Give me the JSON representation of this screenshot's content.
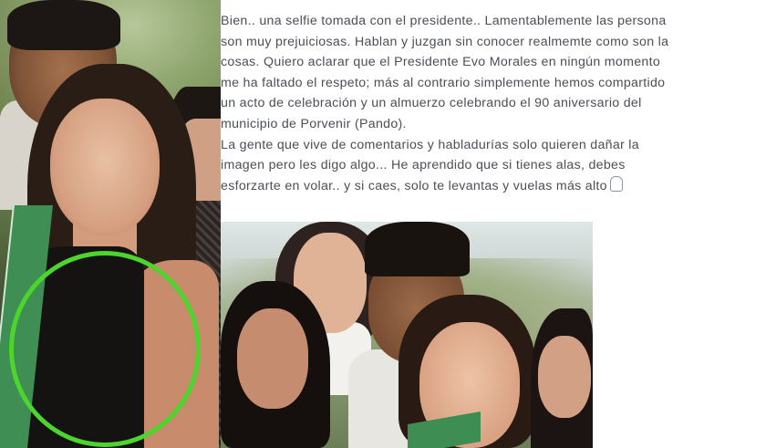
{
  "post": {
    "lines": [
      "Bien.. una selfie tomada con el presidente.. Lamentablemente las persona",
      "son muy prejuiciosas. Hablan y juzgan sin conocer realmemte como son la",
      "cosas. Quiero aclarar que el Presidente Evo Morales en ningún momento",
      "me ha faltado el respeto; más al contrario simplemente hemos compartido",
      "un acto de celebración y un almuerzo celebrando el 90 aniversario del",
      "municipio de Porvenir (Pando).",
      "La gente que vive de comentarios y habladurías solo quieren dañar la",
      "imagen pero les digo algo... He aprendido que si tienes alas, debes",
      "esforzarte en volar.. y si caes, solo te levantas y vuelas más alto"
    ],
    "emoji_icon": "praying-hands-icon"
  },
  "colors": {
    "highlight_circle": "#4cd52c",
    "text": "#4b4f56",
    "sash": "#3f8f54"
  }
}
